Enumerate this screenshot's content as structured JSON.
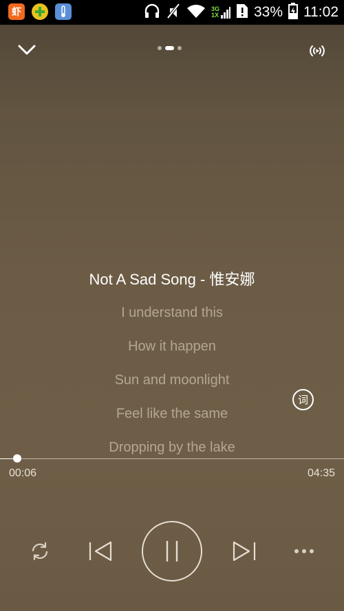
{
  "status_bar": {
    "app_icons": [
      {
        "name": "xiami-app-icon",
        "glyph": "虾",
        "color": "#f2691e"
      },
      {
        "name": "plus-app-icon",
        "glyph": "✚",
        "color": "#3aaa35"
      },
      {
        "name": "thermometer-app-icon",
        "glyph": "🌡",
        "color": "#5a8fd8"
      }
    ],
    "network_badge_top": "3G",
    "network_badge_bottom": "1X",
    "battery_percent": "33%",
    "time": "11:02"
  },
  "header": {
    "page_count": 3,
    "active_page": 1
  },
  "lyrics": {
    "lines": [
      "Not A Sad Song - 惟安娜",
      "I understand this",
      "How it happen",
      "Sun and moonlight",
      "Feel like the same",
      "Dropping by the lake"
    ],
    "current_index": 0,
    "lyric_button_label": "词"
  },
  "playback": {
    "elapsed": "00:06",
    "duration": "04:35",
    "progress_fraction": 0.022,
    "state": "playing"
  },
  "colors": {
    "background": "#6c5c46",
    "text_primary": "#ffffff",
    "text_secondary": "#d4c8b6"
  }
}
